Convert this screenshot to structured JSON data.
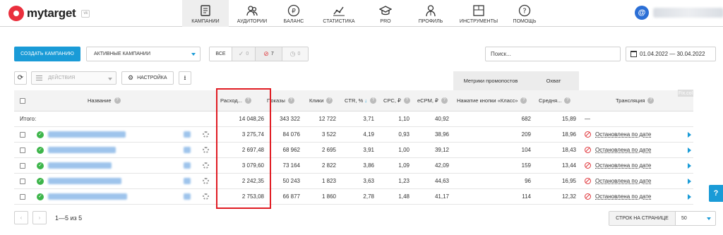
{
  "brand": {
    "name": "mytarget",
    "badge": "vk"
  },
  "nav": [
    {
      "label": "КАМПАНИИ",
      "icon": "campaigns-icon",
      "active": true
    },
    {
      "label": "АУДИТОРИИ",
      "icon": "audiences-icon"
    },
    {
      "label": "БАЛАНС",
      "icon": "ruble-icon"
    },
    {
      "label": "СТАТИСТИКА",
      "icon": "statistics-icon"
    },
    {
      "label": "PRO",
      "icon": "graduation-cap-icon"
    },
    {
      "label": "ПРОФИЛЬ",
      "icon": "profile-icon"
    },
    {
      "label": "ИНСТРУМЕНТЫ",
      "icon": "tools-icon"
    },
    {
      "label": "ПОМОЩЬ",
      "icon": "help-icon"
    }
  ],
  "user": {
    "avatar_symbol": "@"
  },
  "toolbar": {
    "create_label": "СОЗДАТЬ КАМПАНИЮ",
    "campaign_filter": "АКТИВНЫЕ КАМПАНИИ",
    "filters": {
      "all": "ВСЕ",
      "ok_count": "0",
      "stopped_count": "7",
      "pending_count": "0"
    },
    "search_placeholder": "Поиск...",
    "date_range": "01.04.2022 — 30.04.2022",
    "actions_label": "ДЕЙСТВИЯ",
    "settings_label": "НАСТРОЙКА"
  },
  "groups": {
    "promo_metrics": "Метрики промопостов",
    "reach": "Охват"
  },
  "columns": {
    "name": "Название",
    "spend": "Расход...",
    "impressions": "Показы",
    "clicks": "Клики",
    "ctr": "CTR, %",
    "cpc": "CPC, ₽",
    "ecpm": "eCPM, ₽",
    "class_clicks": "Нажатие кнопки «Класс»",
    "avg": "Средня...",
    "broadcast": "Трансляция",
    "fix_col": "Fix.col"
  },
  "total": {
    "label": "Итого:",
    "spend": "14 048,26",
    "impressions": "343 322",
    "clicks": "12 722",
    "ctr": "3,71",
    "cpc": "1,10",
    "ecpm": "40,92",
    "class_clicks": "682",
    "avg": "15,89",
    "broadcast": "—"
  },
  "rows": [
    {
      "spend": "3 275,74",
      "impressions": "84 076",
      "clicks": "3 522",
      "ctr": "4,19",
      "cpc": "0,93",
      "ecpm": "38,96",
      "class_clicks": "209",
      "avg": "18,96",
      "broadcast": "Остановлена по дате"
    },
    {
      "spend": "2 697,48",
      "impressions": "68 962",
      "clicks": "2 695",
      "ctr": "3,91",
      "cpc": "1,00",
      "ecpm": "39,12",
      "class_clicks": "104",
      "avg": "18,43",
      "broadcast": "Остановлена по дате"
    },
    {
      "spend": "3 079,60",
      "impressions": "73 164",
      "clicks": "2 822",
      "ctr": "3,86",
      "cpc": "1,09",
      "ecpm": "42,09",
      "class_clicks": "159",
      "avg": "13,44",
      "broadcast": "Остановлена по дате"
    },
    {
      "spend": "2 242,35",
      "impressions": "50 243",
      "clicks": "1 823",
      "ctr": "3,63",
      "cpc": "1,23",
      "ecpm": "44,63",
      "class_clicks": "96",
      "avg": "16,95",
      "broadcast": "Остановлена по дате"
    },
    {
      "spend": "2 753,08",
      "impressions": "66 877",
      "clicks": "1 860",
      "ctr": "2,78",
      "cpc": "1,48",
      "ecpm": "41,17",
      "class_clicks": "114",
      "avg": "12,32",
      "broadcast": "Остановлена по дате"
    }
  ],
  "pagination": {
    "range": "1—5 из 5",
    "rows_per_page_label": "СТРОК НА СТРАНИЦЕ",
    "rows_per_page": "50"
  },
  "help_tab": "?",
  "colors": {
    "accent": "#1a9bd7",
    "success": "#3db54a",
    "danger": "#e0393e",
    "highlight_box": "#e01b22"
  }
}
